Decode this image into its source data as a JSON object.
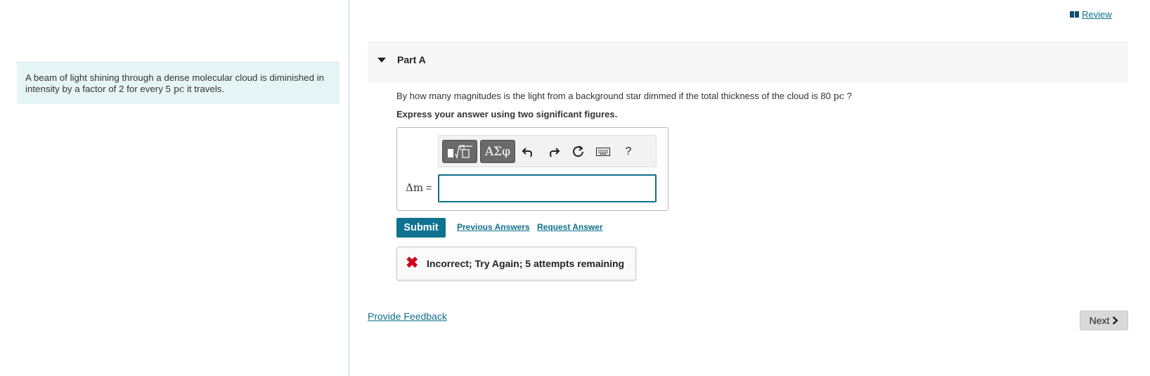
{
  "context": {
    "intro_pre": "A beam of light shining through a dense molecular cloud is diminished in intensity by a factor of 2 for every 5 ",
    "intro_unit": "pc",
    "intro_post": " it travels."
  },
  "header": {
    "review_label": "Review",
    "review_icon": "book-icon"
  },
  "part": {
    "title": "Part A",
    "question_pre": "By how many magnitudes is the light from a background star dimmed if the total thickness of the cloud is 80 ",
    "question_unit": "pc",
    "question_post": " ?",
    "instructions": "Express your answer using two significant figures."
  },
  "toolbar": {
    "templates_icon": "templates-icon",
    "symbols_label": "ΑΣφ",
    "undo_icon": "undo-icon",
    "redo_icon": "redo-icon",
    "reset_icon": "reset-icon",
    "keyboard_icon": "keyboard-icon",
    "help_label": "?"
  },
  "answer": {
    "label_var": "Δm",
    "label_eq": " =",
    "value": ""
  },
  "actions": {
    "submit_label": "Submit",
    "previous_answers_label": "Previous Answers",
    "request_answer_label": "Request Answer"
  },
  "feedback": {
    "status_icon": "x-icon",
    "message": "Incorrect; Try Again; 5 attempts remaining",
    "status_color": "#d0021b"
  },
  "footer": {
    "provide_feedback_label": "Provide Feedback",
    "next_label": "Next"
  },
  "colors": {
    "accent": "#0f7290",
    "context_bg": "#e5f5f6"
  }
}
